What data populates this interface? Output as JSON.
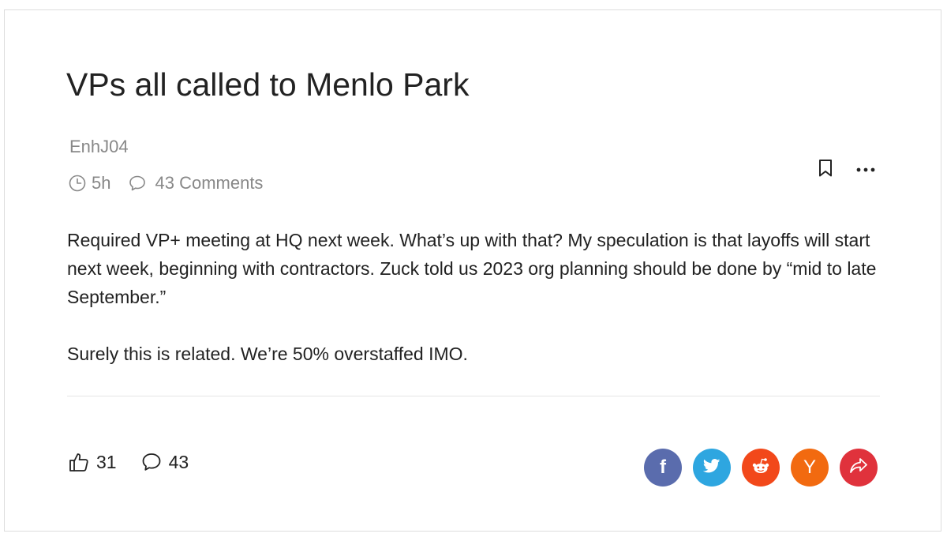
{
  "post": {
    "title": "VPs all called to Menlo Park",
    "author": "EnhJ04",
    "time_ago": "5h",
    "comments_label": "43 Comments",
    "body": [
      "Required VP+ meeting at HQ next week. What’s up with that? My speculation is that layoffs will start next week, beginning with contractors. Zuck told us 2023 org planning should be done by “mid to late September.”",
      "Surely this is related. We’re 50% overstaffed IMO."
    ]
  },
  "stats": {
    "likes": "31",
    "comments": "43"
  },
  "icons": {
    "time": "clock-icon",
    "comments": "speech-bubble-icon",
    "bookmark": "bookmark-icon",
    "more": "more-dots-icon",
    "like": "thumbs-up-icon"
  },
  "share": [
    {
      "name": "facebook",
      "glyph": "f",
      "color": "#5a6cad"
    },
    {
      "name": "twitter",
      "glyph": "",
      "color": "#2ea6e0"
    },
    {
      "name": "reddit",
      "glyph": "",
      "color": "#f2481a"
    },
    {
      "name": "hacker-news",
      "glyph": "Y",
      "color": "#f26a10"
    },
    {
      "name": "share",
      "glyph": "",
      "color": "#e0323c"
    }
  ]
}
